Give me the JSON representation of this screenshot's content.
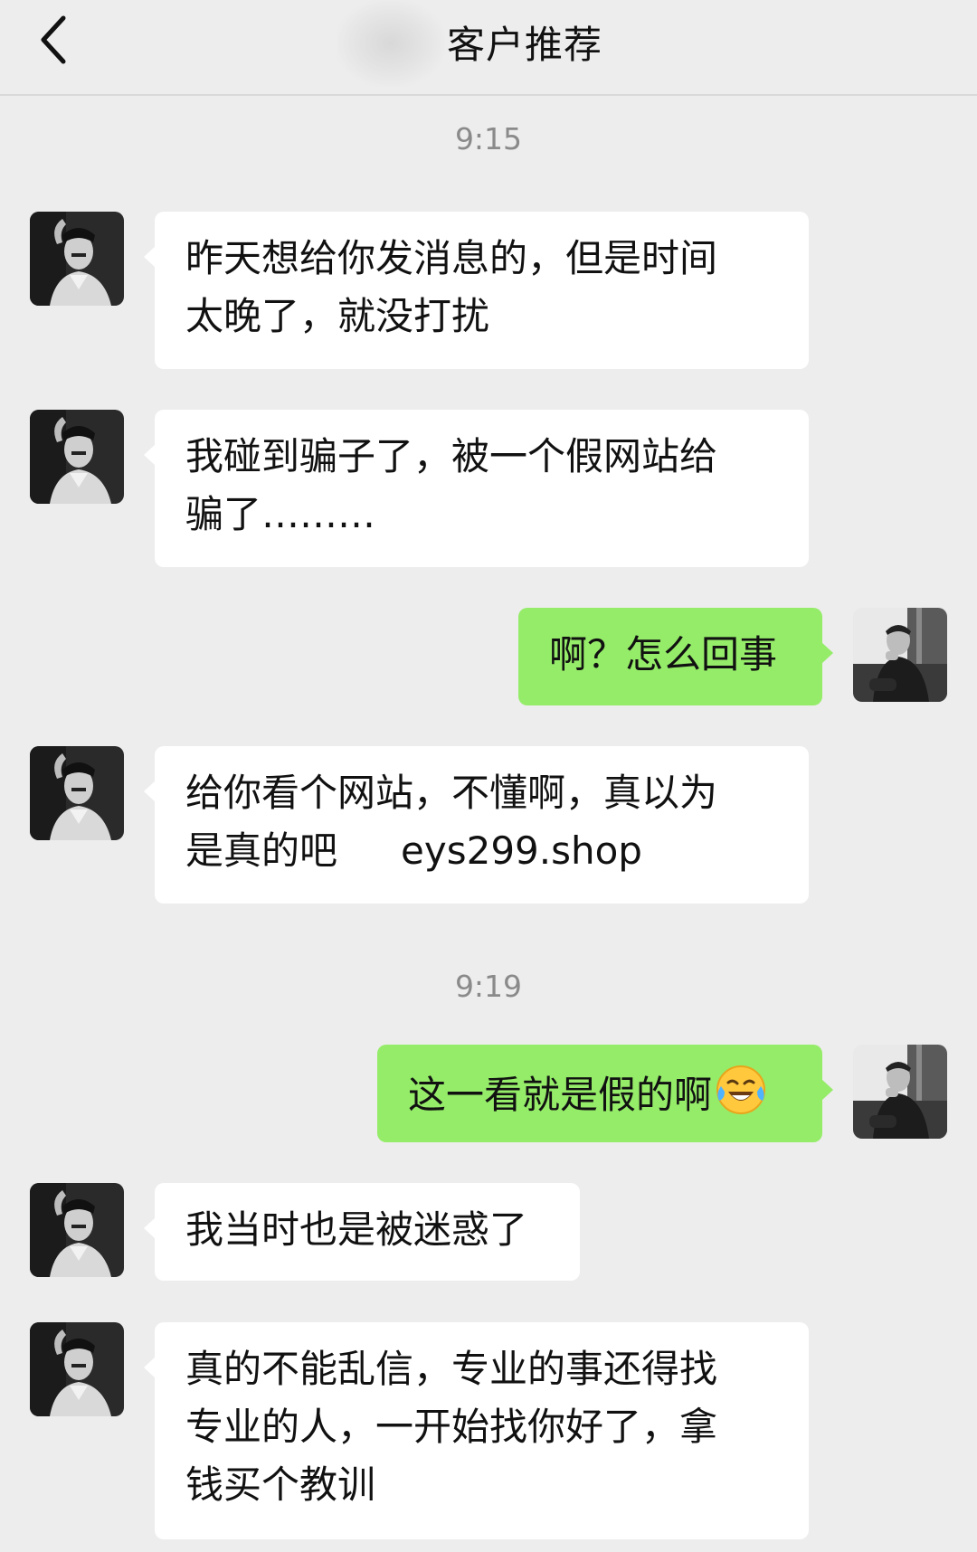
{
  "header": {
    "title": "客户推荐",
    "back_icon": "chevron-left-icon"
  },
  "messages": [
    {
      "type": "time",
      "text": "9:15"
    },
    {
      "type": "in",
      "text": "昨天想给你发消息的，但是时间\n太晚了，就没打扰"
    },
    {
      "type": "in",
      "text": "我碰到骗子了，被一个假网站给\n骗了………"
    },
    {
      "type": "out",
      "text": "啊？怎么回事"
    },
    {
      "type": "in",
      "text": "给你看个网站，不懂啊，真以为\n是真的吧",
      "url": "eys299.shop"
    },
    {
      "type": "time",
      "text": "9:19"
    },
    {
      "type": "out",
      "text": "这一看就是假的啊",
      "emoji": "crying-laughing-emoji"
    },
    {
      "type": "in",
      "text": "我当时也是被迷惑了"
    },
    {
      "type": "in",
      "text": "真的不能乱信，专业的事还得找\n专业的人，一开始找你好了，拿\n钱买个教训"
    }
  ],
  "colors": {
    "background": "#ededed",
    "incoming_bubble": "#ffffff",
    "outgoing_bubble": "#95ec69",
    "timestamp": "#8a8a8a"
  }
}
